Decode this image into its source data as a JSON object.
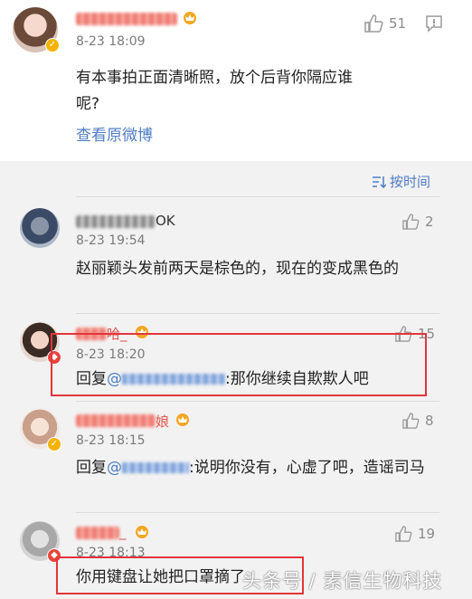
{
  "top_comment": {
    "time": "8-23 18:09",
    "likes": "51",
    "text": "有本事拍正面清晰照，放个后背你隔应谁呢?",
    "view_original": "查看原微博"
  },
  "sort": {
    "label": "按时间"
  },
  "comments": [
    {
      "name_suffix": "OK",
      "time": "8-23 19:54",
      "likes": "2",
      "text": "赵丽颖头发前两天是棕色的，现在的变成黑色的"
    },
    {
      "name_suffix": "哈_",
      "time": "8-23 18:20",
      "likes": "15",
      "reply_prefix": "回复",
      "at": "@",
      "text": ":那你继续自欺欺人吧"
    },
    {
      "name_suffix": "娘",
      "time": "8-23 18:15",
      "likes": "8",
      "reply_prefix": "回复",
      "at": "@",
      "text": ":说明你没有，心虚了吧，造谣司马"
    },
    {
      "name_suffix": "_",
      "time": "8-23 18:13",
      "likes": "19",
      "text": "你用键盘让她把口罩摘了"
    }
  ],
  "watermark": "头条号 / 素信生物科技",
  "colors": {
    "accent_link": "#4f7dc4",
    "highlight_box": "#e2363a",
    "vip_name": "#e5554b"
  }
}
